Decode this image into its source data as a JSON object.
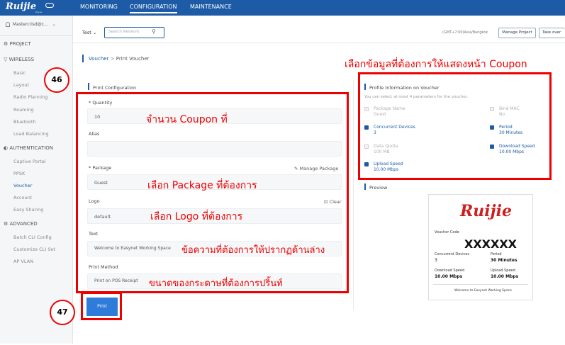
{
  "topbar": {
    "brand": "Ruijie",
    "brand_sub": "Reyee",
    "nav": [
      "MONITORING",
      "CONFIGURATION",
      "MAINTENANCE"
    ]
  },
  "sidebar": {
    "user": "Mastercrisd@c...",
    "project": "PROJECT",
    "wireless": "WIRELESS",
    "wireless_items": [
      "Basic",
      "Layout",
      "Radio Planning",
      "Roaming",
      "Bluetooth",
      "Load Balancing"
    ],
    "authentication": "AUTHENTICATION",
    "auth_items": [
      "Captive Portal",
      "PPSK",
      "Voucher",
      "Account",
      "Easy Sharing"
    ],
    "advanced": "ADVANCED",
    "adv_items": [
      "Batch CLI Config",
      "Customize CLI Set",
      "AP VLAN"
    ]
  },
  "secondbar": {
    "project_name": "Test",
    "search_placeholder": "Search Network",
    "timezone": "(GMT+7:00)Asia/Bangkok",
    "manage_project": "Manage Project",
    "take_over": "Take over"
  },
  "breadcrumb": {
    "parent": "Voucher",
    "sep": ">",
    "current": "Print Voucher"
  },
  "form": {
    "section_title": "Print Configuration",
    "quantity_label": "* Quantity",
    "quantity_value": "10",
    "alias_label": "Alias",
    "package_label": "* Package",
    "manage_package": "Manage Package",
    "package_value": "Guest",
    "logo_label": "Logo",
    "logo_clear": "Clear",
    "logo_value": "default",
    "text_label": "Text",
    "text_value": "Welcome to Easynet Working Space",
    "print_method_label": "Print Method",
    "print_method_value": "Print on POS Receipt",
    "print_button": "Print"
  },
  "profile": {
    "title": "Profile Information on Voucher",
    "hint": "You can select at most 4 parameters for the voucher.",
    "options": [
      {
        "name": "Package Name",
        "value": "Guest",
        "checked": false
      },
      {
        "name": "Bind MAC",
        "value": "No",
        "checked": false
      },
      {
        "name": "Concurrent Devices",
        "value": "3",
        "checked": true
      },
      {
        "name": "Period",
        "value": "30 Minutes",
        "checked": true
      },
      {
        "name": "Data Quota",
        "value": "100 MB",
        "checked": false
      },
      {
        "name": "Download Speed",
        "value": "10.00 Mbps",
        "checked": true
      },
      {
        "name": "Upload Speed",
        "value": "10.00 Mbps",
        "checked": true
      }
    ]
  },
  "preview": {
    "title": "Preview",
    "logo": "Ruijie",
    "voucher_code_label": "Voucher Code",
    "voucher_code": "XXXXXX",
    "concurrent_label": "Concurrent Devices",
    "concurrent_value": "3",
    "period_label": "Period",
    "period_value": "30 Minutes",
    "download_label": "Download Speed",
    "download_value": "10.00 Mbps",
    "upload_label": "Upload Speed",
    "upload_value": "10.00 Mbps",
    "welcome": "Welcome to Easynet Working Space"
  },
  "annotations": {
    "step46": "46",
    "step47": "47",
    "profile_note": "เลือกข้อมูลที่ต้องการให้แสดงหน้า  Coupon",
    "quantity_note": "จำนวน Coupon ที่",
    "package_note": "เลือก Package ที่ต้องการ",
    "logo_note": "เลือก Logo ที่ต้องการ",
    "text_note": "ข้อความที่ต้องการให้ปรากฏด้านล่าง",
    "paper_note": "ขนาดของกระดาษที่ต้องการปริ้นท์"
  },
  "colors": {
    "brand_blue": "#1d5ba7",
    "annotation_red": "#e00000",
    "print_button": "#2f7bd9",
    "preview_logo_red": "#cc1f1f"
  }
}
